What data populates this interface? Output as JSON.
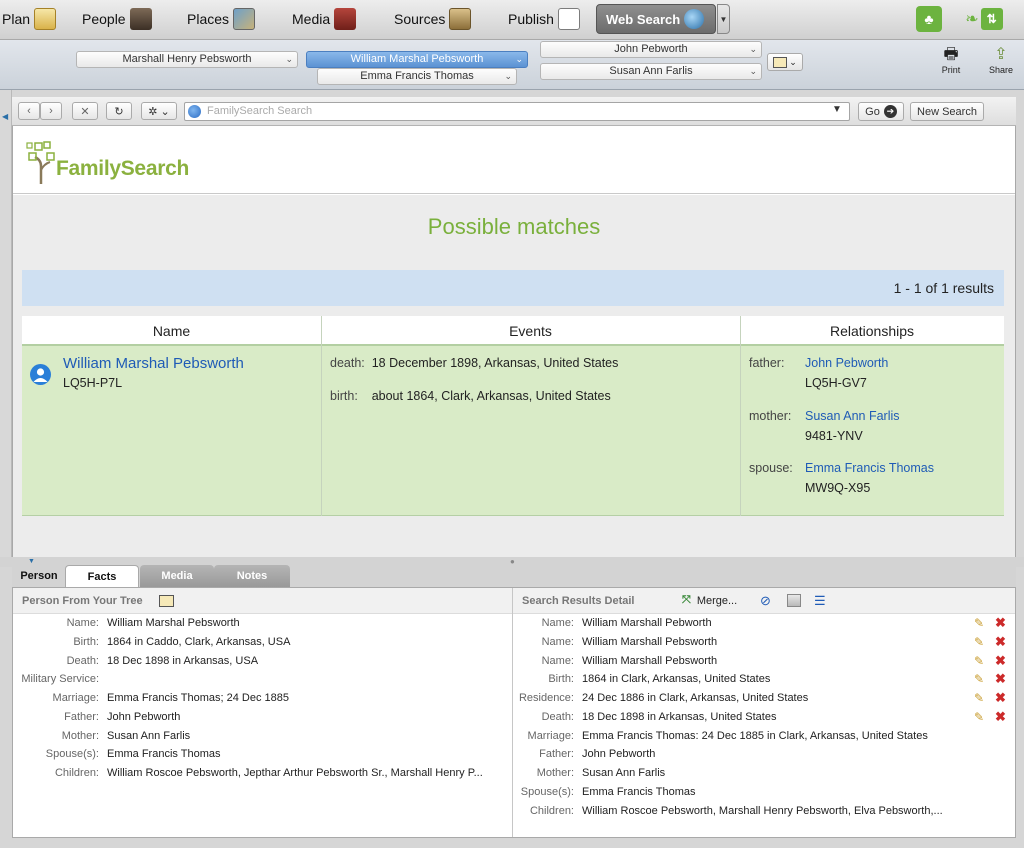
{
  "toolbar": {
    "plan": "Plan",
    "people": "People",
    "places": "Places",
    "media": "Media",
    "sources": "Sources",
    "publish": "Publish",
    "web_search": "Web Search"
  },
  "person_bar": {
    "paternal_left": "Marshall Henry Pebsworth",
    "selected": "William Marshal Pebsworth",
    "spouse": "Emma Francis Thomas",
    "father": "John Pebworth",
    "mother": "Susan Ann Farlis",
    "print_label": "Print",
    "share_label": "Share"
  },
  "browser": {
    "url_placeholder": "FamilySearch Search",
    "go_label": "Go",
    "new_search_label": "New Search"
  },
  "page": {
    "logo_text": "FamilySearch",
    "heading": "Possible matches",
    "results_count": "1 - 1 of 1 results",
    "columns": {
      "name": "Name",
      "events": "Events",
      "relationships": "Relationships"
    },
    "match": {
      "name": "William Marshal Pebsworth",
      "id": "LQ5H-P7L",
      "events": [
        {
          "label": "death:",
          "value": "18 December 1898, Arkansas, United States"
        },
        {
          "label": "birth:",
          "value": "about 1864, Clark, Arkansas, United States"
        }
      ],
      "relationships": [
        {
          "label": "father:",
          "name": "John Pebworth",
          "id": "LQ5H-GV7"
        },
        {
          "label": "mother:",
          "name": "Susan Ann Farlis",
          "id": "9481-YNV"
        },
        {
          "label": "spouse:",
          "name": "Emma Francis Thomas",
          "id": "MW9Q-X95"
        }
      ]
    }
  },
  "tabs": {
    "person": "Person",
    "facts": "Facts",
    "media": "Media",
    "notes": "Notes"
  },
  "left_panel": {
    "title": "Person From Your Tree",
    "facts": [
      {
        "label": "Name:",
        "value": "William Marshal Pebsworth"
      },
      {
        "label": "Birth:",
        "value": "1864 in Caddo, Clark, Arkansas, USA"
      },
      {
        "label": "Death:",
        "value": "18 Dec 1898 in Arkansas, USA"
      },
      {
        "label": "Military Service:",
        "value": ""
      },
      {
        "label": "Marriage:",
        "value": "Emma Francis Thomas; 24 Dec 1885"
      },
      {
        "label": "Father:",
        "value": "John Pebworth"
      },
      {
        "label": "Mother:",
        "value": "Susan Ann Farlis"
      },
      {
        "label": "Spouse(s):",
        "value": "Emma Francis Thomas"
      },
      {
        "label": "Children:",
        "value": "William Roscoe Pebsworth, Jepthar Arthur Pebsworth Sr., Marshall Henry P..."
      }
    ]
  },
  "right_panel": {
    "title": "Search Results Detail",
    "merge_label": "Merge...",
    "facts": [
      {
        "label": "Name:",
        "value": "William Marshall Pebworth"
      },
      {
        "label": "Name:",
        "value": "William Marshall Pebsworth"
      },
      {
        "label": "Name:",
        "value": "William Marshall Pebsworth"
      },
      {
        "label": "Birth:",
        "value": "1864 in Clark, Arkansas, United States"
      },
      {
        "label": "Residence:",
        "value": "24 Dec 1886 in Clark, Arkansas, United States"
      },
      {
        "label": "Death:",
        "value": "18 Dec 1898 in Arkansas, United States"
      },
      {
        "label": "Marriage:",
        "value": "Emma Francis Thomas: 24 Dec 1885 in Clark, Arkansas, United States"
      },
      {
        "label": "Father:",
        "value": "John Pebworth"
      },
      {
        "label": "Mother:",
        "value": "Susan Ann Farlis"
      },
      {
        "label": "Spouse(s):",
        "value": "Emma Francis Thomas"
      },
      {
        "label": "Children:",
        "value": "William Roscoe Pebsworth, Marshall Henry Pebsworth, Elva Pebsworth,..."
      }
    ]
  },
  "colors": {
    "accent_green": "#7ab03c",
    "link_blue": "#1f5bb6",
    "match_row": "#d9ebc7",
    "results_bar": "#cfe0f2"
  }
}
